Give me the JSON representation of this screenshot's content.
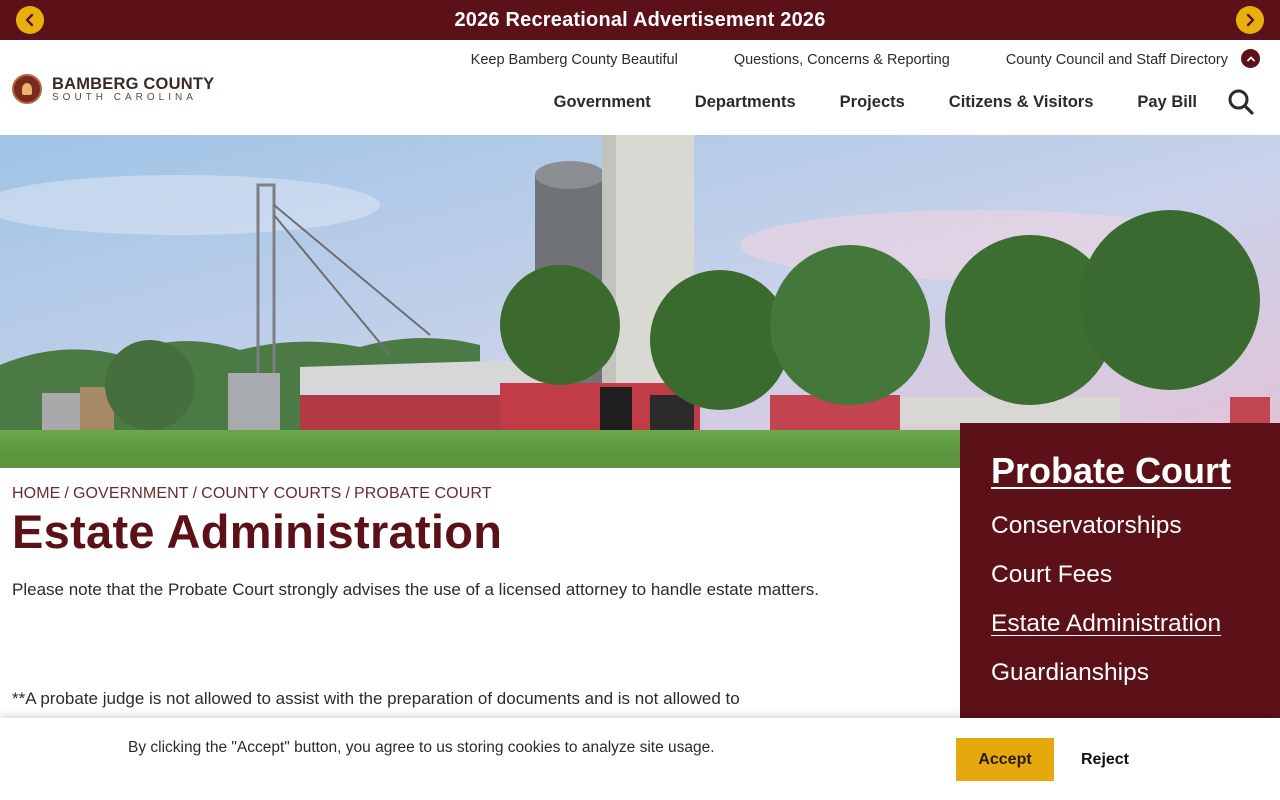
{
  "alert": {
    "text": "2026 Recreational Advertisement 2026"
  },
  "logo": {
    "name": "BAMBERG COUNTY",
    "tagline": "SOUTH CAROLINA"
  },
  "utility_nav": [
    {
      "label": "Keep Bamberg County Beautiful"
    },
    {
      "label": "Questions, Concerns & Reporting"
    },
    {
      "label": "County Council and Staff Directory"
    }
  ],
  "main_nav": [
    {
      "label": "Government"
    },
    {
      "label": "Departments"
    },
    {
      "label": "Projects"
    },
    {
      "label": "Citizens & Visitors"
    },
    {
      "label": "Pay Bill"
    }
  ],
  "breadcrumb": [
    "HOME",
    "GOVERNMENT",
    "COUNTY COURTS",
    "PROBATE COURT"
  ],
  "page": {
    "title": "Estate Administration",
    "paragraph1": "Please note that the Probate Court strongly advises the use of a licensed attorney to handle estate matters.",
    "paragraph2": "**A probate judge is not allowed to assist with the preparation of documents and is not allowed to"
  },
  "sidebar": {
    "title": "Probate Court",
    "items": [
      {
        "label": "Conservatorships",
        "active": false
      },
      {
        "label": "Court Fees",
        "active": false
      },
      {
        "label": "Estate Administration",
        "active": true
      },
      {
        "label": "Guardianships",
        "active": false
      }
    ]
  },
  "cookie": {
    "text": "By clicking the \"Accept\" button, you agree to us storing cookies to analyze site usage.",
    "accept_label": "Accept",
    "reject_label": "Reject"
  },
  "colors": {
    "brand_maroon": "#5c1118",
    "accent_gold": "#e3a90f"
  }
}
